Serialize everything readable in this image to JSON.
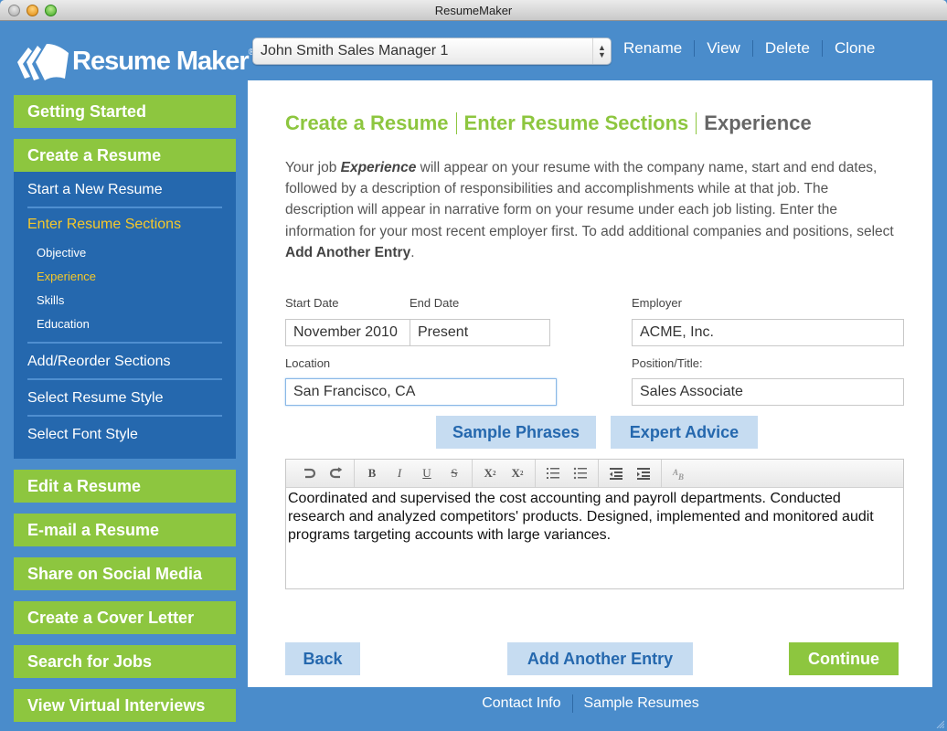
{
  "window": {
    "title": "ResumeMaker"
  },
  "header": {
    "logo_text": "Resume Maker",
    "logo_mark": "®",
    "resume_select": {
      "value": "John Smith Sales Manager 1"
    },
    "links": [
      "Rename",
      "View",
      "Delete",
      "Clone"
    ]
  },
  "sidebar": {
    "getting_started": "Getting Started",
    "create_resume": {
      "label": "Create a Resume",
      "start_new": "Start a New Resume",
      "enter_sections": {
        "label": "Enter Resume Sections",
        "children": [
          {
            "label": "Objective",
            "active": false
          },
          {
            "label": "Experience",
            "active": true
          },
          {
            "label": "Skills",
            "active": false
          },
          {
            "label": "Education",
            "active": false
          }
        ]
      },
      "add_reorder": "Add/Reorder Sections",
      "select_style": "Select Resume Style",
      "select_font": "Select Font Style"
    },
    "items": [
      "Edit a Resume",
      "E-mail a Resume",
      "Share on Social Media",
      "Create a Cover Letter",
      "Search for Jobs",
      "View Virtual Interviews"
    ]
  },
  "main": {
    "breadcrumb": {
      "crumbs": [
        "Create a Resume",
        "Enter Resume Sections"
      ],
      "current": "Experience"
    },
    "intro": {
      "part1": "Your job ",
      "emph": "Experience",
      "part2": " will appear on your resume with the company name, start and end dates, followed by a description of responsibilities and accomplishments while at that job. The description will appear in narrative form on your resume under each job listing. Enter the information for your most recent employer first. To add additional companies and positions, select ",
      "strong": "Add Another Entry",
      "part3": "."
    },
    "fields": {
      "start_date": {
        "label": "Start Date",
        "value": "November 2010"
      },
      "end_date": {
        "label": "End Date",
        "value": "Present"
      },
      "employer": {
        "label": "Employer",
        "value": "ACME, Inc."
      },
      "location": {
        "label": "Location",
        "value": "San Francisco, CA"
      },
      "position": {
        "label": "Position/Title:",
        "value": "Sales Associate"
      }
    },
    "helper_buttons": {
      "sample_phrases": "Sample Phrases",
      "expert_advice": "Expert Advice"
    },
    "editor": {
      "toolbar": [
        [
          "undo-icon",
          "redo-icon"
        ],
        [
          "bold-icon",
          "italic-icon",
          "underline-icon",
          "strikethrough-icon"
        ],
        [
          "subscript-icon",
          "superscript-icon"
        ],
        [
          "numbered-list-icon",
          "bulleted-list-icon"
        ],
        [
          "outdent-icon",
          "indent-icon"
        ],
        [
          "spellcheck-icon"
        ]
      ],
      "content": "Coordinated and supervised the cost accounting and payroll departments. Conducted research and analyzed competitors' products. Designed, implemented and monitored audit programs targeting accounts with large variances."
    },
    "actions": {
      "back": "Back",
      "add_another": "Add Another Entry",
      "continue": "Continue"
    }
  },
  "footer": {
    "links": [
      "Contact Info",
      "Sample Resumes"
    ]
  },
  "colors": {
    "brand_blue": "#4a8ccb",
    "nav_green": "#8dc63f",
    "subnav_blue": "#2568ae",
    "active_yellow": "#f6c82a",
    "button_light": "#c6dcf1"
  }
}
